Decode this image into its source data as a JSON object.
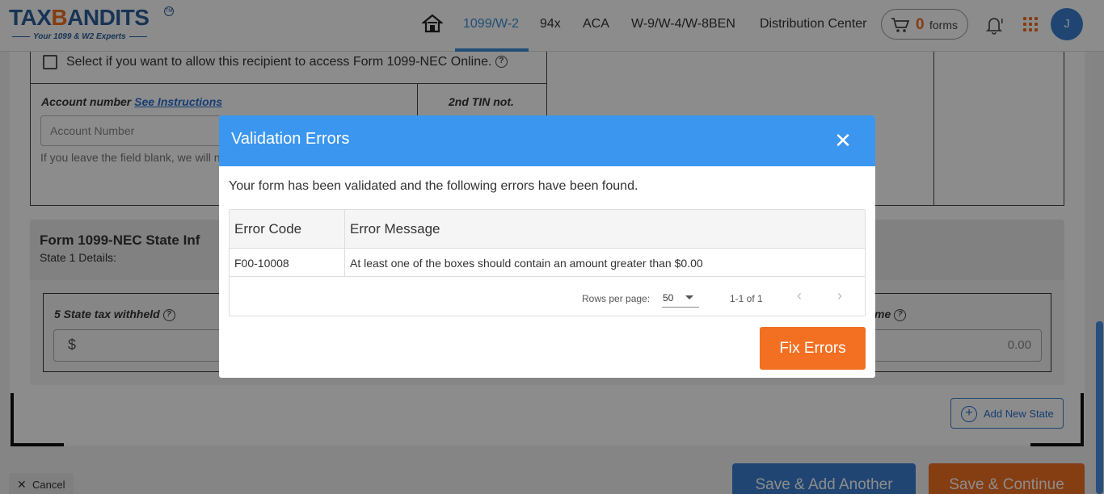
{
  "header": {
    "logo_text": "TAX",
    "logo_owl": "B",
    "logo_text2": "ANDITS",
    "logo_tm": "TM",
    "logo_tagline": "Your 1099 & W2 Experts",
    "home_icon": "home-icon",
    "nav": [
      "1099/W-2",
      "94x",
      "ACA",
      "W-9/W-4/W-8BEN",
      "Distribution Center"
    ],
    "cart_count": "0",
    "cart_label": "forms",
    "avatar_initial": "J",
    "accent_color": "#3b8fd9",
    "brand_orange": "#f36f21"
  },
  "form": {
    "online_access_label": "Select if you want to allow this recipient to access Form 1099-NEC Online.",
    "account_label": "Account number",
    "account_link": "See Instructions",
    "account_placeholder": "Account Number",
    "account_help": "If you leave the field blank, we will number for this recipient.",
    "tin_label": "2nd TIN not.",
    "state_title": "Form 1099-NEC State Inf",
    "state_sub": "State 1 Details:",
    "state_withheld_label": "5 State tax withheld",
    "currency_symbol": "$",
    "state_income_label": "me",
    "state_income_value": "0.00",
    "help_glyph": "?"
  },
  "actions": {
    "add_state": "Add New State",
    "cancel": "Cancel",
    "save_add": "Save & Add Another",
    "save_continue": "Save & Continue"
  },
  "modal": {
    "title": "Validation Errors",
    "close_glyph": "✕",
    "message": "Your form has been validated and the following errors have been found.",
    "columns": [
      "Error Code",
      "Error Message"
    ],
    "rows": [
      {
        "code": "F00-10008",
        "message": "At least one of the boxes should contain an amount greater than $0.00"
      }
    ],
    "rows_per_page_label": "Rows per page:",
    "rows_per_page_value": "50",
    "range": "1-1 of 1",
    "prev_glyph": "‹",
    "next_glyph": "›",
    "fix_button": "Fix Errors",
    "header_color": "#3b96ef"
  }
}
